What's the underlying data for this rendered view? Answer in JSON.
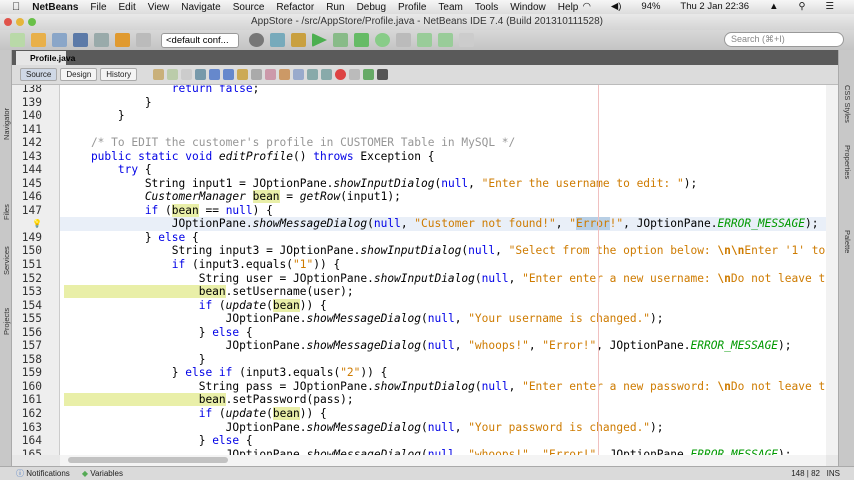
{
  "menubar": {
    "app": "NetBeans",
    "items": [
      "File",
      "Edit",
      "View",
      "Navigate",
      "Source",
      "Refactor",
      "Run",
      "Debug",
      "Profile",
      "Team",
      "Tools",
      "Window",
      "Help"
    ],
    "battery": "94%",
    "clock": "Thu 2 Jan  22:36"
  },
  "window": {
    "title": "AppStore - /src/AppStore/Profile.java - NetBeans IDE 7.4 (Build 201310111528)"
  },
  "toolbar": {
    "config": "<default conf...",
    "search_placeholder": "Search (⌘+I)"
  },
  "editor": {
    "tab": "Profile.java",
    "views": [
      "Source",
      "Design",
      "History"
    ],
    "active_view": "Source"
  },
  "sidebars": {
    "left": [
      "Navigator",
      "Files",
      "Services",
      "Projects"
    ],
    "right": [
      "CSS Styles",
      "Properties",
      "Palette"
    ]
  },
  "code": {
    "lines": [
      {
        "n": "138",
        "t": [
          [
            "k",
            "                return "
          ],
          [
            "k",
            "false"
          ],
          [
            "t",
            ";"
          ]
        ]
      },
      {
        "n": "139",
        "t": [
          [
            "t",
            "            }"
          ]
        ]
      },
      {
        "n": "140",
        "t": [
          [
            "t",
            "        }"
          ]
        ]
      },
      {
        "n": "141",
        "t": []
      },
      {
        "n": "142",
        "t": [
          [
            "c",
            "    /* To EDIT the customer's profile in CUSTOMER Table in MySQL */"
          ]
        ]
      },
      {
        "n": "143",
        "t": [
          [
            "k",
            "    public static void "
          ],
          [
            "m",
            "editProfile"
          ],
          [
            "t",
            "() "
          ],
          [
            "k",
            "throws"
          ],
          [
            "t",
            " Exception {"
          ]
        ]
      },
      {
        "n": "144",
        "t": [
          [
            "k",
            "        try"
          ],
          [
            "t",
            " {"
          ]
        ]
      },
      {
        "n": "145",
        "t": [
          [
            "t",
            "            String input1 = JOptionPane."
          ],
          [
            "m",
            "showInputDialog"
          ],
          [
            "t",
            "("
          ],
          [
            "k",
            "null"
          ],
          [
            "t",
            ", "
          ],
          [
            "s",
            "\"Enter the username to edit: \""
          ],
          [
            "t",
            ");"
          ]
        ]
      },
      {
        "n": "146",
        "t": [
          [
            "m",
            "            CustomerManager "
          ],
          [
            "h",
            "bean"
          ],
          [
            "t",
            " = "
          ],
          [
            "m",
            "getRow"
          ],
          [
            "t",
            "(input1);"
          ]
        ]
      },
      {
        "n": "147",
        "t": [
          [
            "k",
            "            if"
          ],
          [
            "t",
            " ("
          ],
          [
            "h",
            "bean"
          ],
          [
            "t",
            " == "
          ],
          [
            "k",
            "null"
          ],
          [
            "t",
            ") {"
          ]
        ]
      },
      {
        "n": "148",
        "cur": true,
        "t": [
          [
            "t",
            "                JOptionPane."
          ],
          [
            "m",
            "showMessageDialog"
          ],
          [
            "t",
            "("
          ],
          [
            "k",
            "null"
          ],
          [
            "t",
            ", "
          ],
          [
            "s",
            "\"Customer not found!\""
          ],
          [
            "t",
            ", "
          ],
          [
            "s",
            "\""
          ],
          [
            "sel",
            "Error"
          ],
          [
            "s",
            "!\""
          ],
          [
            "t",
            ", JOptionPane."
          ],
          [
            "f",
            "ERROR_MESSAGE"
          ],
          [
            "t",
            ");"
          ]
        ]
      },
      {
        "n": "149",
        "t": [
          [
            "t",
            "            } "
          ],
          [
            "k",
            "else"
          ],
          [
            "t",
            " {"
          ]
        ]
      },
      {
        "n": "150",
        "t": [
          [
            "t",
            "                String input3 = JOptionPane."
          ],
          [
            "m",
            "showInputDialog"
          ],
          [
            "t",
            "("
          ],
          [
            "k",
            "null"
          ],
          [
            "t",
            ", "
          ],
          [
            "s",
            "\"Select from the option below: "
          ],
          [
            "e",
            "\\n\\n"
          ],
          [
            "s",
            "Enter '1' to"
          ]
        ]
      },
      {
        "n": "151",
        "t": [
          [
            "k",
            "                if"
          ],
          [
            "t",
            " (input3.equals("
          ],
          [
            "s",
            "\"1\""
          ],
          [
            "t",
            ")) {"
          ]
        ]
      },
      {
        "n": "152",
        "t": [
          [
            "t",
            "                    String user = JOptionPane."
          ],
          [
            "m",
            "showInputDialog"
          ],
          [
            "t",
            "("
          ],
          [
            "k",
            "null"
          ],
          [
            "t",
            ", "
          ],
          [
            "s",
            "\"Enter enter a new username: "
          ],
          [
            "e",
            "\\n"
          ],
          [
            "s",
            "Do not leave t"
          ]
        ]
      },
      {
        "n": "153",
        "t": [
          [
            "h",
            "                    bean"
          ],
          [
            "t",
            ".setUsername(user);"
          ]
        ]
      },
      {
        "n": "154",
        "t": [
          [
            "k",
            "                    if"
          ],
          [
            "t",
            " ("
          ],
          [
            "m",
            "update"
          ],
          [
            "t",
            "("
          ],
          [
            "h",
            "bean"
          ],
          [
            "t",
            ")) {"
          ]
        ]
      },
      {
        "n": "155",
        "t": [
          [
            "t",
            "                        JOptionPane."
          ],
          [
            "m",
            "showMessageDialog"
          ],
          [
            "t",
            "("
          ],
          [
            "k",
            "null"
          ],
          [
            "t",
            ", "
          ],
          [
            "s",
            "\"Your username is changed.\""
          ],
          [
            "t",
            ");"
          ]
        ]
      },
      {
        "n": "156",
        "t": [
          [
            "t",
            "                    } "
          ],
          [
            "k",
            "else"
          ],
          [
            "t",
            " {"
          ]
        ]
      },
      {
        "n": "157",
        "t": [
          [
            "t",
            "                        JOptionPane."
          ],
          [
            "m",
            "showMessageDialog"
          ],
          [
            "t",
            "("
          ],
          [
            "k",
            "null"
          ],
          [
            "t",
            ", "
          ],
          [
            "s",
            "\"whoops!\""
          ],
          [
            "t",
            ", "
          ],
          [
            "s",
            "\"Error!\""
          ],
          [
            "t",
            ", JOptionPane."
          ],
          [
            "f",
            "ERROR_MESSAGE"
          ],
          [
            "t",
            ");"
          ]
        ]
      },
      {
        "n": "158",
        "t": [
          [
            "t",
            "                    }"
          ]
        ]
      },
      {
        "n": "159",
        "t": [
          [
            "t",
            "                } "
          ],
          [
            "k",
            "else if"
          ],
          [
            "t",
            " (input3.equals("
          ],
          [
            "s",
            "\"2\""
          ],
          [
            "t",
            ")) {"
          ]
        ]
      },
      {
        "n": "160",
        "t": [
          [
            "t",
            "                    String pass = JOptionPane."
          ],
          [
            "m",
            "showInputDialog"
          ],
          [
            "t",
            "("
          ],
          [
            "k",
            "null"
          ],
          [
            "t",
            ", "
          ],
          [
            "s",
            "\"Enter enter a new password: "
          ],
          [
            "e",
            "\\n"
          ],
          [
            "s",
            "Do not leave t"
          ]
        ]
      },
      {
        "n": "161",
        "t": [
          [
            "h",
            "                    bean"
          ],
          [
            "t",
            ".setPassword(pass);"
          ]
        ]
      },
      {
        "n": "162",
        "t": [
          [
            "k",
            "                    if"
          ],
          [
            "t",
            " ("
          ],
          [
            "m",
            "update"
          ],
          [
            "t",
            "("
          ],
          [
            "h",
            "bean"
          ],
          [
            "t",
            ")) {"
          ]
        ]
      },
      {
        "n": "163",
        "t": [
          [
            "t",
            "                        JOptionPane."
          ],
          [
            "m",
            "showMessageDialog"
          ],
          [
            "t",
            "("
          ],
          [
            "k",
            "null"
          ],
          [
            "t",
            ", "
          ],
          [
            "s",
            "\"Your password is changed.\""
          ],
          [
            "t",
            ");"
          ]
        ]
      },
      {
        "n": "164",
        "t": [
          [
            "t",
            "                    } "
          ],
          [
            "k",
            "else"
          ],
          [
            "t",
            " {"
          ]
        ]
      },
      {
        "n": "165",
        "t": [
          [
            "t",
            "                        JOptionPane."
          ],
          [
            "m",
            "showMessageDialog"
          ],
          [
            "t",
            "("
          ],
          [
            "k",
            "null"
          ],
          [
            "t",
            ", "
          ],
          [
            "s",
            "\"whoops!\""
          ],
          [
            "t",
            ", "
          ],
          [
            "s",
            "\"Error!\""
          ],
          [
            "t",
            ", JOptionPane."
          ],
          [
            "f",
            "ERROR_MESSAGE"
          ],
          [
            "t",
            ");"
          ]
        ]
      }
    ]
  },
  "status": {
    "notifications": "Notifications",
    "variables": "Variables",
    "position": "148 | 82",
    "mode": "INS"
  }
}
